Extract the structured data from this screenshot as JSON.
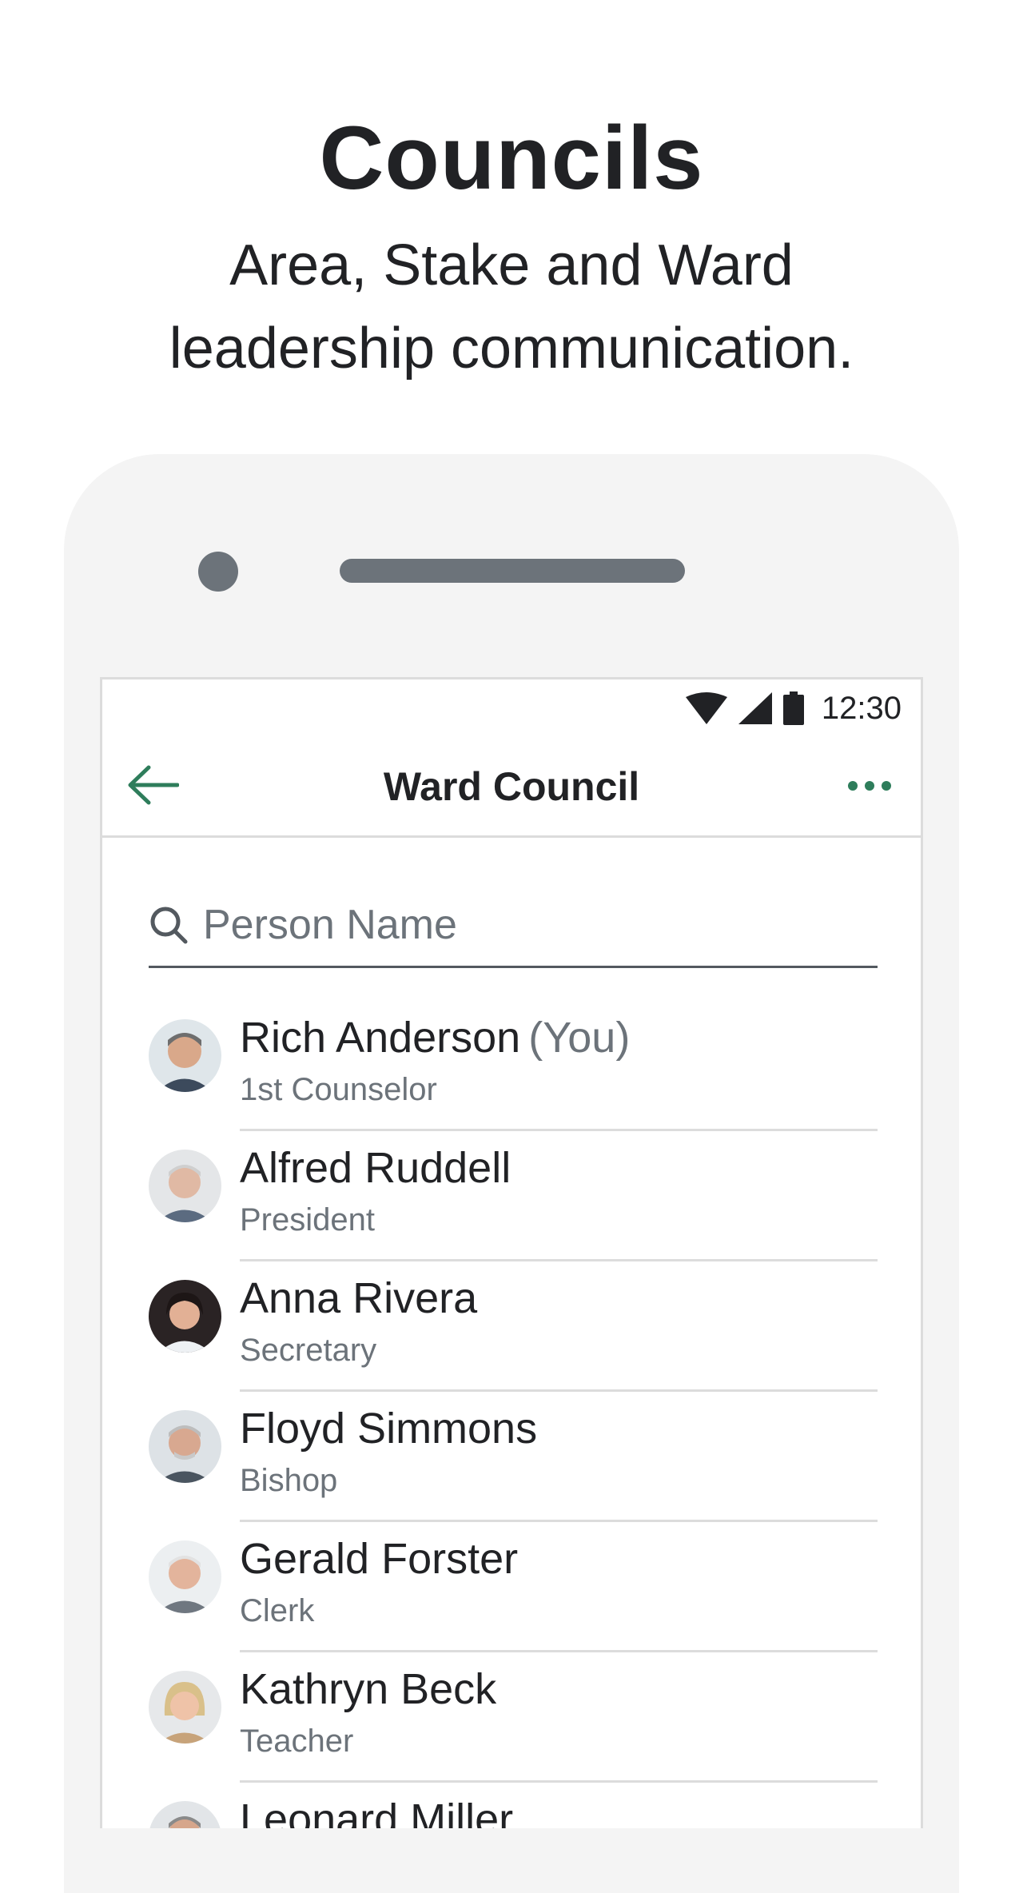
{
  "promo": {
    "title": "Councils",
    "subtitle_line1": "Area, Stake and Ward",
    "subtitle_line2": "leadership communication."
  },
  "status_bar": {
    "time": "12:30",
    "icons": [
      "wifi-icon",
      "cell-signal-icon",
      "battery-icon"
    ]
  },
  "app_bar": {
    "title": "Ward Council",
    "back_icon": "arrow-left-icon",
    "more_icon": "more-horizontal-icon"
  },
  "search": {
    "placeholder": "Person Name",
    "value": ""
  },
  "members": [
    {
      "name": "Rich Anderson",
      "you_label": "(You)",
      "role": "1st Counselor"
    },
    {
      "name": "Alfred Ruddell",
      "role": "President"
    },
    {
      "name": "Anna Rivera",
      "role": "Secretary"
    },
    {
      "name": "Floyd Simmons",
      "role": "Bishop"
    },
    {
      "name": "Gerald Forster",
      "role": "Clerk"
    },
    {
      "name": "Kathryn Beck",
      "role": "Teacher"
    },
    {
      "name": "Leonard Miller",
      "role": ""
    }
  ],
  "colors": {
    "accent": "#2e7d5b",
    "text_primary": "#212225",
    "text_secondary": "#6c737a",
    "divider": "#dcdcdc",
    "device_body": "#f4f4f4"
  }
}
